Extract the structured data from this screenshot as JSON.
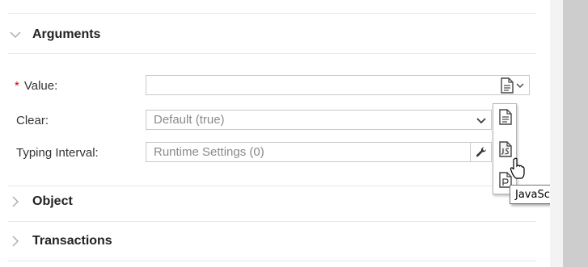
{
  "sections": [
    {
      "id": "arguments",
      "label": "Arguments",
      "expanded": true
    },
    {
      "id": "object",
      "label": "Object",
      "expanded": false
    },
    {
      "id": "transactions",
      "label": "Transactions",
      "expanded": false
    }
  ],
  "arguments": {
    "value": {
      "label": "Value:",
      "required_marker": "*",
      "value": ""
    },
    "clear": {
      "label": "Clear:",
      "value": "Default (true)"
    },
    "typing_interval": {
      "label": "Typing Interval:",
      "value": "Runtime Settings (0)"
    }
  },
  "value_type_dropdown": {
    "items": [
      {
        "icon": "text-document-icon"
      },
      {
        "icon": "javascript-icon",
        "hovered": true
      },
      {
        "icon": "parameter-icon"
      }
    ]
  },
  "tooltip": {
    "text": "JavaScript"
  },
  "colors": {
    "required": "#d0021b",
    "border": "#c9c9c9",
    "scrollbar_thumb": "#cdcdcd"
  }
}
